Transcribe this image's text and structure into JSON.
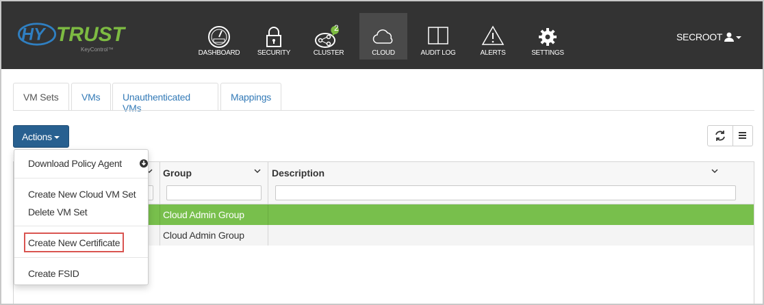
{
  "brand": {
    "logo_left": "HY",
    "logo_right": "TRUST",
    "product": "KeyControl™"
  },
  "nav": {
    "items": [
      {
        "label": "DASHBOARD",
        "icon": "dashboard-gauge-icon"
      },
      {
        "label": "SECURITY",
        "icon": "lock-icon"
      },
      {
        "label": "CLUSTER",
        "icon": "cluster-nodes-icon",
        "badge": "2"
      },
      {
        "label": "CLOUD",
        "icon": "cloud-icon",
        "active": true
      },
      {
        "label": "AUDIT LOG",
        "icon": "book-icon"
      },
      {
        "label": "ALERTS",
        "icon": "warning-triangle-icon"
      },
      {
        "label": "SETTINGS",
        "icon": "gear-icon"
      }
    ],
    "user": "SECROOT"
  },
  "tabs": [
    {
      "label": "VM Sets",
      "active": true
    },
    {
      "label": "VMs"
    },
    {
      "label": "Unauthenticated VMs"
    },
    {
      "label": "Mappings"
    }
  ],
  "toolbar": {
    "actions_label": "Actions"
  },
  "actions_menu": {
    "items": [
      "Download Policy Agent",
      "Create New Cloud VM Set",
      "Delete VM Set",
      "Create New Certificate",
      "Create FSID"
    ],
    "highlighted": "Create New Certificate"
  },
  "table": {
    "columns": [
      "Group",
      "Description"
    ],
    "rows": [
      {
        "group": "Cloud Admin Group",
        "description": "",
        "selected": true
      },
      {
        "group": "Cloud Admin Group",
        "description": "",
        "selected": false
      }
    ]
  },
  "colors": {
    "topbar": "#333333",
    "brand_blue": "#2f7fc1",
    "brand_green": "#7dbb42",
    "primary_button": "#286090",
    "selected_row": "#78bf4c",
    "highlight_border": "#d9534f",
    "cluster_badge": "#7dbb42"
  }
}
